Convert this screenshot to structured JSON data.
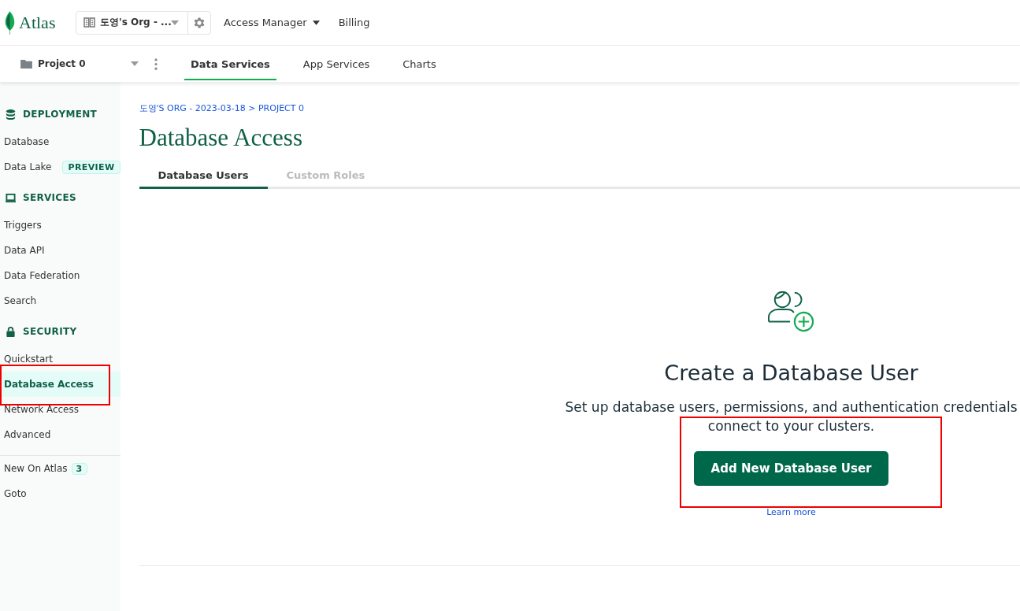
{
  "topbar": {
    "logo": "Atlas",
    "org": "도영's Org - ...",
    "nav": [
      {
        "label": "Access Manager",
        "dropdown": true
      },
      {
        "label": "Billing",
        "dropdown": false
      }
    ]
  },
  "project_bar": {
    "project": "Project 0",
    "tabs": [
      {
        "label": "Data Services",
        "selected": true
      },
      {
        "label": "App Services",
        "selected": false
      },
      {
        "label": "Charts",
        "selected": false
      }
    ]
  },
  "sidebar": {
    "sections": [
      {
        "title": "DEPLOYMENT",
        "items": [
          {
            "label": "Database",
            "selected": false
          },
          {
            "label": "Data Lake",
            "badge": "PREVIEW",
            "selected": false
          }
        ]
      },
      {
        "title": "SERVICES",
        "items": [
          {
            "label": "Triggers",
            "selected": false
          },
          {
            "label": "Data API",
            "selected": false
          },
          {
            "label": "Data Federation",
            "selected": false
          },
          {
            "label": "Search",
            "selected": false
          }
        ]
      },
      {
        "title": "SECURITY",
        "items": [
          {
            "label": "Quickstart",
            "selected": false
          },
          {
            "label": "Database Access",
            "selected": true
          },
          {
            "label": "Network Access",
            "selected": false
          },
          {
            "label": "Advanced",
            "selected": false
          }
        ]
      }
    ],
    "footer": [
      {
        "label": "New On Atlas",
        "badge": "3"
      },
      {
        "label": "Goto"
      }
    ]
  },
  "breadcrumb": "도영'S ORG - 2023-03-18 > PROJECT 0",
  "page_title": "Database Access",
  "tabs": [
    {
      "label": "Database Users",
      "selected": true
    },
    {
      "label": "Custom Roles",
      "selected": false
    }
  ],
  "empty_state": {
    "title": "Create a Database User",
    "description_lines": [
      "Set up database users, permissions, and authentication credentials",
      "connect to your clusters."
    ],
    "button": "Add New Database User",
    "link": "Learn more"
  }
}
